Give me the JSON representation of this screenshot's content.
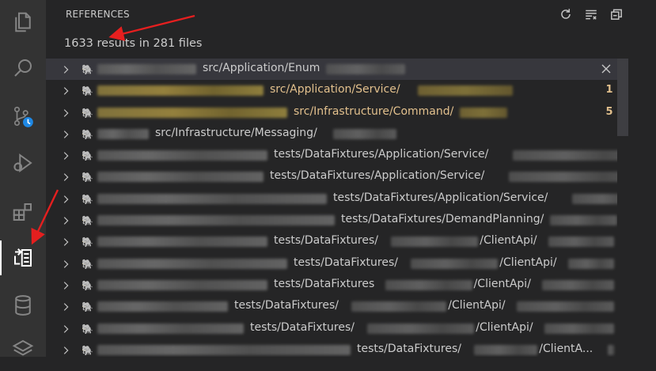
{
  "activity_bar": {
    "icons": [
      {
        "name": "explorer-icon"
      },
      {
        "name": "search-icon"
      },
      {
        "name": "source-control-icon"
      },
      {
        "name": "run-debug-icon"
      },
      {
        "name": "extensions-icon"
      },
      {
        "name": "references-icon"
      },
      {
        "name": "database-icon"
      },
      {
        "name": "layers-icon"
      }
    ],
    "active": "references-icon"
  },
  "panel": {
    "title": "REFERENCES",
    "actions": [
      "refresh-icon",
      "clear-all-icon",
      "collapse-all-icon"
    ],
    "summary": "1633 results in 281 files"
  },
  "results": [
    {
      "path": "src/Application/Enum",
      "badge": "",
      "modified": false,
      "selected": true
    },
    {
      "path": "src/Application/Service/",
      "badge": "1",
      "modified": true,
      "selected": false
    },
    {
      "path": "src/Infrastructure/Command/",
      "badge": "5",
      "modified": true,
      "selected": false
    },
    {
      "path": "src/Infrastructure/Messaging/",
      "badge": "",
      "modified": false,
      "selected": false
    },
    {
      "path": "tests/DataFixtures/Application/Service/",
      "badge": "",
      "modified": false,
      "selected": false
    },
    {
      "path": "tests/DataFixtures/Application/Service/",
      "badge": "",
      "modified": false,
      "selected": false
    },
    {
      "path": "tests/DataFixtures/Application/Service/",
      "badge": "",
      "modified": false,
      "selected": false
    },
    {
      "path": "tests/DataFixtures/DemandPlanning/",
      "badge": "",
      "modified": false,
      "selected": false
    },
    {
      "path": "tests/DataFixtures/",
      "path2": "/ClientApi/",
      "badge": "",
      "modified": false,
      "selected": false
    },
    {
      "path": "tests/DataFixtures/",
      "path2": "/ClientApi/",
      "badge": "",
      "modified": false,
      "selected": false
    },
    {
      "path": "tests/DataFixtures",
      "path2": "/ClientApi/",
      "badge": "",
      "modified": false,
      "selected": false
    },
    {
      "path": "tests/DataFixtures/",
      "path2": "/ClientApi/",
      "badge": "",
      "modified": false,
      "selected": false
    },
    {
      "path": "tests/DataFixtures/",
      "path2": "/ClientApi/",
      "badge": "",
      "modified": false,
      "selected": false
    },
    {
      "path": "tests/DataFixtures/",
      "path2": "/ClientA...",
      "badge": "",
      "modified": false,
      "selected": false
    }
  ],
  "colors": {
    "activity_bar": "#333333",
    "panel": "#252526",
    "modified_text": "#e2c08d",
    "php_icon": "#b57ee5",
    "annotation_arrow": "#e51f1f",
    "debug_badge": "#1e88e5"
  }
}
